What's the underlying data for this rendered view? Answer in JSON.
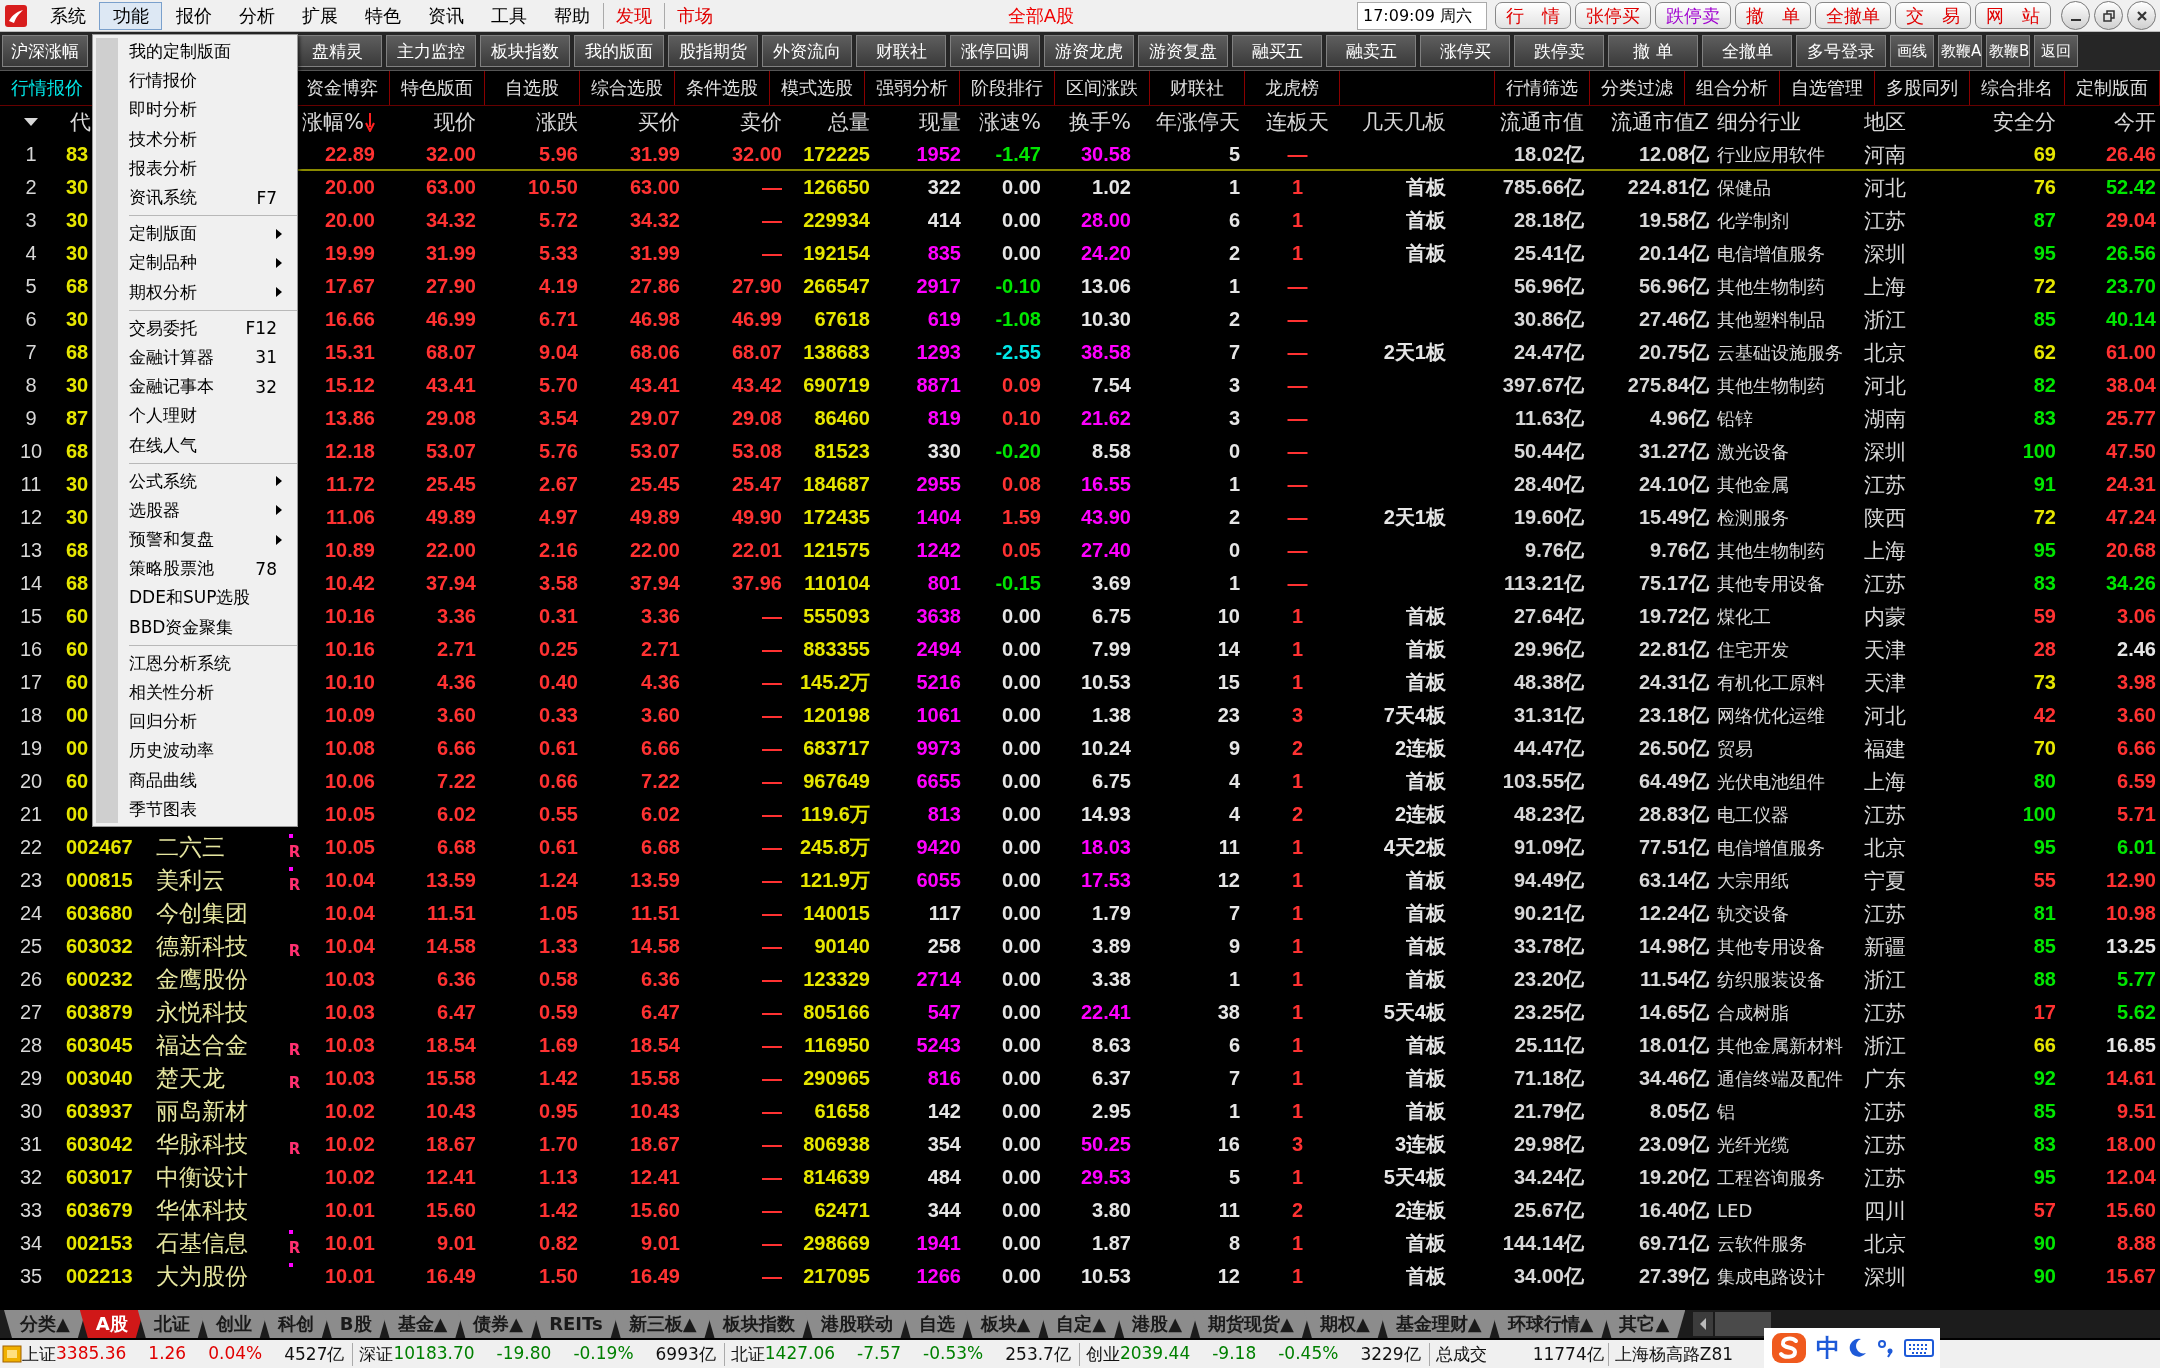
{
  "menubar": {
    "items": [
      {
        "label": "系统",
        "selected": false
      },
      {
        "label": "功能",
        "selected": true
      },
      {
        "label": "报价",
        "selected": false
      },
      {
        "label": "分析",
        "selected": false
      },
      {
        "label": "扩展",
        "selected": false
      },
      {
        "label": "特色",
        "selected": false
      },
      {
        "label": "资讯",
        "selected": false
      },
      {
        "label": "工具",
        "selected": false
      },
      {
        "label": "帮助",
        "selected": false
      }
    ],
    "links": [
      "发现",
      "市场"
    ],
    "title": "全部A股",
    "clock": "17:09:09 周六",
    "buttons": [
      {
        "label": "行　情",
        "color": "#e00000"
      },
      {
        "label": "张停买",
        "color": "#e00000"
      },
      {
        "label": "跌停卖",
        "color": "#a000d0"
      },
      {
        "label": "撤　单",
        "color": "#e00000"
      },
      {
        "label": "全撤单",
        "color": "#e00000"
      },
      {
        "label": "交　易",
        "color": "#e00000"
      },
      {
        "label": "网　站",
        "color": "#e00000"
      }
    ]
  },
  "toolbar": {
    "first": "沪深涨幅",
    "buttons": [
      {
        "label": "盘精灵",
        "kind": "wide"
      },
      {
        "label": "主力监控",
        "kind": "wide"
      },
      {
        "label": "板块指数",
        "kind": "wide"
      },
      {
        "label": "我的版面",
        "kind": "wide"
      },
      {
        "label": "股指期货",
        "kind": "wide"
      },
      {
        "label": "外资流向",
        "kind": "wide"
      },
      {
        "label": "财联社",
        "kind": "wide"
      },
      {
        "label": "涨停回调",
        "kind": "wide"
      },
      {
        "label": "游资龙虎",
        "kind": "wide"
      },
      {
        "label": "游资复盘",
        "kind": "wide"
      },
      {
        "label": "融买五",
        "kind": "wide"
      },
      {
        "label": "融卖五",
        "kind": "wide"
      },
      {
        "label": "涨停买",
        "kind": "wide"
      },
      {
        "label": "跌停卖",
        "kind": "wide"
      },
      {
        "label": "撤 单",
        "kind": "wide"
      },
      {
        "label": "全撤单",
        "kind": "wide"
      },
      {
        "label": "多号登录",
        "kind": "wide"
      },
      {
        "label": "画线",
        "kind": "small"
      },
      {
        "label": "教鞭A",
        "kind": "small"
      },
      {
        "label": "教鞭B",
        "kind": "small"
      },
      {
        "label": "返回",
        "kind": "small"
      }
    ]
  },
  "tabs_left": [
    {
      "label": "行情报价",
      "selected": true
    },
    {
      "label": "资金博弈",
      "selected": false
    },
    {
      "label": "特色版面",
      "selected": false
    },
    {
      "label": "自选股",
      "selected": false
    },
    {
      "label": "综合选股",
      "selected": false
    },
    {
      "label": "条件选股",
      "selected": false
    },
    {
      "label": "模式选股",
      "selected": false
    },
    {
      "label": "强弱分析",
      "selected": false
    },
    {
      "label": "阶段排行",
      "selected": false
    },
    {
      "label": "区间涨跌",
      "selected": false
    },
    {
      "label": "财联社",
      "selected": false
    },
    {
      "label": "龙虎榜",
      "selected": false
    }
  ],
  "tabs_right": [
    {
      "label": "行情筛选",
      "selected": false
    },
    {
      "label": "分类过滤",
      "selected": false
    },
    {
      "label": "组合分析",
      "selected": false
    },
    {
      "label": "自选管理",
      "selected": false
    },
    {
      "label": "多股同列",
      "selected": false
    },
    {
      "label": "综合排名",
      "selected": false
    },
    {
      "label": "定制版面",
      "selected": false
    }
  ],
  "table": {
    "code_header": "代",
    "columns": [
      {
        "label": "涨幅%",
        "sorted": true
      },
      {
        "label": "现价",
        "sorted": false
      },
      {
        "label": "涨跌",
        "sorted": false
      },
      {
        "label": "买价",
        "sorted": false
      },
      {
        "label": "卖价",
        "sorted": false
      },
      {
        "label": "总量",
        "sorted": false
      },
      {
        "label": "现量",
        "sorted": false
      },
      {
        "label": "涨速%",
        "sorted": false
      },
      {
        "label": "换手%",
        "sorted": false
      },
      {
        "label": "年涨停天",
        "sorted": false
      },
      {
        "label": "连板天",
        "sorted": false
      },
      {
        "label": "几天几板",
        "sorted": false
      },
      {
        "label": "流通市值",
        "sorted": false
      },
      {
        "label": "流通市值Z",
        "sorted": false
      },
      {
        "label": "细分行业",
        "sorted": false
      },
      {
        "label": "地区",
        "sorted": false
      },
      {
        "label": "安全分",
        "sorted": false
      },
      {
        "label": "今开",
        "sorted": false
      }
    ],
    "rows": [
      {
        "no": "1",
        "code": "83",
        "selected": true,
        "cells": [
          "22.89",
          "32.00",
          "5.96",
          "31.99",
          "32.00",
          "172225",
          {
            "text": "1952",
            "color": "#ff00ff"
          },
          {
            "text": "-1.47",
            "color": "#00e600"
          },
          {
            "text": "30.58",
            "color": "#ff00ff"
          },
          "5",
          "—",
          null,
          "18.02亿",
          "12.08亿",
          "行业应用软件",
          "河南",
          {
            "text": "69",
            "color": "#e6e600"
          },
          {
            "text": "26.46",
            "color": "#ff3232"
          }
        ]
      },
      {
        "no": "2",
        "code": "30",
        "selected": false,
        "cells": [
          "20.00",
          "63.00",
          "10.50",
          "63.00",
          "—",
          "126650",
          {
            "text": "322",
            "color": "#e6e6e6"
          },
          {
            "text": "0.00",
            "color": "#e6e6e6"
          },
          {
            "text": "1.02",
            "color": "#e6e6e6"
          },
          "1",
          "1",
          "首板",
          "785.66亿",
          "224.81亿",
          "保健品",
          "河北",
          {
            "text": "76",
            "color": "#e6e600"
          },
          {
            "text": "52.42",
            "color": "#00e600"
          }
        ]
      },
      {
        "no": "3",
        "code": "30",
        "selected": false,
        "cells": [
          "20.00",
          "34.32",
          "5.72",
          "34.32",
          "—",
          "229934",
          {
            "text": "414",
            "color": "#e6e6e6"
          },
          {
            "text": "0.00",
            "color": "#e6e6e6"
          },
          {
            "text": "28.00",
            "color": "#ff00ff"
          },
          "6",
          "1",
          "首板",
          "28.18亿",
          "19.58亿",
          "化学制剂",
          "江苏",
          {
            "text": "87",
            "color": "#00e600"
          },
          {
            "text": "29.04",
            "color": "#ff3232"
          }
        ]
      },
      {
        "no": "4",
        "code": "30",
        "selected": false,
        "cells": [
          "19.99",
          "31.99",
          "5.33",
          "31.99",
          "—",
          "192154",
          {
            "text": "835",
            "color": "#ff00ff"
          },
          {
            "text": "0.00",
            "color": "#e6e6e6"
          },
          {
            "text": "24.20",
            "color": "#ff00ff"
          },
          "2",
          "1",
          "首板",
          "25.41亿",
          "20.14亿",
          "电信增值服务",
          "深圳",
          {
            "text": "95",
            "color": "#00e600"
          },
          {
            "text": "26.56",
            "color": "#00e600"
          }
        ]
      },
      {
        "no": "5",
        "code": "68",
        "selected": false,
        "cells": [
          "17.67",
          "27.90",
          "4.19",
          "27.86",
          "27.90",
          "266547",
          {
            "text": "2917",
            "color": "#ff00ff"
          },
          {
            "text": "-0.10",
            "color": "#00e600"
          },
          {
            "text": "13.06",
            "color": "#e6e6e6"
          },
          "1",
          "—",
          null,
          "56.96亿",
          "56.96亿",
          "其他生物制药",
          "上海",
          {
            "text": "72",
            "color": "#e6e600"
          },
          {
            "text": "23.70",
            "color": "#00e600"
          }
        ]
      },
      {
        "no": "6",
        "code": "30",
        "selected": false,
        "cells": [
          "16.66",
          "46.99",
          "6.71",
          "46.98",
          "46.99",
          "67618",
          {
            "text": "619",
            "color": "#ff00ff"
          },
          {
            "text": "-1.08",
            "color": "#00e600"
          },
          {
            "text": "10.30",
            "color": "#e6e6e6"
          },
          "2",
          "—",
          null,
          "30.86亿",
          "27.46亿",
          "其他塑料制品",
          "浙江",
          {
            "text": "85",
            "color": "#00e600"
          },
          {
            "text": "40.14",
            "color": "#00e600"
          }
        ]
      },
      {
        "no": "7",
        "code": "68",
        "selected": false,
        "cells": [
          "15.31",
          "68.07",
          "9.04",
          "68.06",
          "68.07",
          "138683",
          {
            "text": "1293",
            "color": "#ff00ff"
          },
          {
            "text": "-2.55",
            "color": "#00e6e6"
          },
          {
            "text": "38.58",
            "color": "#ff00ff"
          },
          "7",
          "—",
          "2天1板",
          "24.47亿",
          "20.75亿",
          "云基础设施服务",
          "北京",
          {
            "text": "62",
            "color": "#e6e600"
          },
          {
            "text": "61.00",
            "color": "#ff3232"
          }
        ]
      },
      {
        "no": "8",
        "code": "30",
        "selected": false,
        "cells": [
          "15.12",
          "43.41",
          "5.70",
          "43.41",
          "43.42",
          "690719",
          {
            "text": "8871",
            "color": "#ff00ff"
          },
          {
            "text": "0.09",
            "color": "#ff3232"
          },
          {
            "text": "7.54",
            "color": "#e6e6e6"
          },
          "3",
          "—",
          null,
          "397.67亿",
          "275.84亿",
          "其他生物制药",
          "河北",
          {
            "text": "82",
            "color": "#00e600"
          },
          {
            "text": "38.04",
            "color": "#ff3232"
          }
        ]
      },
      {
        "no": "9",
        "code": "87",
        "selected": false,
        "cells": [
          "13.86",
          "29.08",
          "3.54",
          "29.07",
          "29.08",
          "86460",
          {
            "text": "819",
            "color": "#ff00ff"
          },
          {
            "text": "0.10",
            "color": "#ff3232"
          },
          {
            "text": "21.62",
            "color": "#ff00ff"
          },
          "3",
          "—",
          null,
          "11.63亿",
          "4.96亿",
          "铅锌",
          "湖南",
          {
            "text": "83",
            "color": "#00e600"
          },
          {
            "text": "25.77",
            "color": "#ff3232"
          }
        ]
      },
      {
        "no": "10",
        "code": "68",
        "selected": false,
        "cells": [
          "12.18",
          "53.07",
          "5.76",
          "53.07",
          "53.08",
          "81523",
          {
            "text": "330",
            "color": "#e6e6e6"
          },
          {
            "text": "-0.20",
            "color": "#00e600"
          },
          {
            "text": "8.58",
            "color": "#e6e6e6"
          },
          "0",
          "—",
          null,
          "50.44亿",
          "31.27亿",
          "激光设备",
          "深圳",
          {
            "text": "100",
            "color": "#00e600"
          },
          {
            "text": "47.50",
            "color": "#ff3232"
          }
        ]
      },
      {
        "no": "11",
        "code": "30",
        "selected": false,
        "cells": [
          "11.72",
          "25.45",
          "2.67",
          "25.45",
          "25.47",
          "184687",
          {
            "text": "2955",
            "color": "#ff00ff"
          },
          {
            "text": "0.08",
            "color": "#ff3232"
          },
          {
            "text": "16.55",
            "color": "#ff00ff"
          },
          "1",
          "—",
          null,
          "28.40亿",
          "24.10亿",
          "其他金属",
          "江苏",
          {
            "text": "91",
            "color": "#00e600"
          },
          {
            "text": "24.31",
            "color": "#ff3232"
          }
        ]
      },
      {
        "no": "12",
        "code": "30",
        "selected": false,
        "cells": [
          "11.06",
          "49.89",
          "4.97",
          "49.89",
          "49.90",
          "172435",
          {
            "text": "1404",
            "color": "#ff00ff"
          },
          {
            "text": "1.59",
            "color": "#ff3232"
          },
          {
            "text": "43.90",
            "color": "#ff00ff"
          },
          "2",
          "—",
          "2天1板",
          "19.60亿",
          "15.49亿",
          "检测服务",
          "陕西",
          {
            "text": "72",
            "color": "#e6e600"
          },
          {
            "text": "47.24",
            "color": "#ff3232"
          }
        ]
      },
      {
        "no": "13",
        "code": "68",
        "selected": false,
        "cells": [
          "10.89",
          "22.00",
          "2.16",
          "22.00",
          "22.01",
          "121575",
          {
            "text": "1242",
            "color": "#ff00ff"
          },
          {
            "text": "0.05",
            "color": "#ff3232"
          },
          {
            "text": "27.40",
            "color": "#ff00ff"
          },
          "0",
          "—",
          null,
          "9.76亿",
          "9.76亿",
          "其他生物制药",
          "上海",
          {
            "text": "95",
            "color": "#00e600"
          },
          {
            "text": "20.68",
            "color": "#ff3232"
          }
        ]
      },
      {
        "no": "14",
        "code": "68",
        "selected": false,
        "cells": [
          "10.42",
          "37.94",
          "3.58",
          "37.94",
          "37.96",
          "110104",
          {
            "text": "801",
            "color": "#ff00ff"
          },
          {
            "text": "-0.15",
            "color": "#00e600"
          },
          {
            "text": "3.69",
            "color": "#e6e6e6"
          },
          "1",
          "—",
          null,
          "113.21亿",
          "75.17亿",
          "其他专用设备",
          "江苏",
          {
            "text": "83",
            "color": "#00e600"
          },
          {
            "text": "34.26",
            "color": "#00e600"
          }
        ]
      },
      {
        "no": "15",
        "code": "60",
        "selected": false,
        "cells": [
          "10.16",
          "3.36",
          "0.31",
          "3.36",
          "—",
          "555093",
          {
            "text": "3638",
            "color": "#ff00ff"
          },
          {
            "text": "0.00",
            "color": "#e6e6e6"
          },
          {
            "text": "6.75",
            "color": "#e6e6e6"
          },
          "10",
          "1",
          "首板",
          "27.64亿",
          "19.72亿",
          "煤化工",
          "内蒙",
          {
            "text": "59",
            "color": "#ff3232"
          },
          {
            "text": "3.06",
            "color": "#ff3232"
          }
        ]
      },
      {
        "no": "16",
        "code": "60",
        "selected": false,
        "cells": [
          "10.16",
          "2.71",
          "0.25",
          "2.71",
          "—",
          "883355",
          {
            "text": "2494",
            "color": "#ff00ff"
          },
          {
            "text": "0.00",
            "color": "#e6e6e6"
          },
          {
            "text": "7.99",
            "color": "#e6e6e6"
          },
          "14",
          "1",
          "首板",
          "29.96亿",
          "22.81亿",
          "住宅开发",
          "天津",
          {
            "text": "28",
            "color": "#ff3232"
          },
          {
            "text": "2.46",
            "color": "#e6e6e6"
          }
        ]
      },
      {
        "no": "17",
        "code": "60",
        "selected": false,
        "cells": [
          "10.10",
          "4.36",
          "0.40",
          "4.36",
          "—",
          "145.2万",
          {
            "text": "5216",
            "color": "#ff00ff"
          },
          {
            "text": "0.00",
            "color": "#e6e6e6"
          },
          {
            "text": "10.53",
            "color": "#e6e6e6"
          },
          "15",
          "1",
          "首板",
          "48.38亿",
          "24.31亿",
          "有机化工原料",
          "天津",
          {
            "text": "73",
            "color": "#e6e600"
          },
          {
            "text": "3.98",
            "color": "#ff3232"
          }
        ]
      },
      {
        "no": "18",
        "code": "00",
        "selected": false,
        "cells": [
          "10.09",
          "3.60",
          "0.33",
          "3.60",
          "—",
          "120198",
          {
            "text": "1061",
            "color": "#ff00ff"
          },
          {
            "text": "0.00",
            "color": "#e6e6e6"
          },
          {
            "text": "1.38",
            "color": "#e6e6e6"
          },
          "23",
          "3",
          "7天4板",
          "31.31亿",
          "23.18亿",
          "网络优化运维",
          "河北",
          {
            "text": "42",
            "color": "#ff3232"
          },
          {
            "text": "3.60",
            "color": "#ff3232"
          }
        ]
      },
      {
        "no": "19",
        "code": "00",
        "selected": false,
        "cells": [
          "10.08",
          "6.66",
          "0.61",
          "6.66",
          "—",
          "683717",
          {
            "text": "9973",
            "color": "#ff00ff"
          },
          {
            "text": "0.00",
            "color": "#e6e6e6"
          },
          {
            "text": "10.24",
            "color": "#e6e6e6"
          },
          "9",
          "2",
          "2连板",
          "44.47亿",
          "26.50亿",
          "贸易",
          "福建",
          {
            "text": "70",
            "color": "#e6e600"
          },
          {
            "text": "6.66",
            "color": "#ff3232"
          }
        ]
      },
      {
        "no": "20",
        "code": "60",
        "selected": false,
        "cells": [
          "10.06",
          "7.22",
          "0.66",
          "7.22",
          "—",
          "967649",
          {
            "text": "6655",
            "color": "#ff00ff"
          },
          {
            "text": "0.00",
            "color": "#e6e6e6"
          },
          {
            "text": "6.75",
            "color": "#e6e6e6"
          },
          "4",
          "1",
          "首板",
          "103.55亿",
          "64.49亿",
          "光伏电池组件",
          "上海",
          {
            "text": "80",
            "color": "#00e600"
          },
          {
            "text": "6.59",
            "color": "#ff3232"
          }
        ]
      },
      {
        "no": "21",
        "code": "00",
        "selected": false,
        "cells": [
          "10.05",
          "6.02",
          "0.55",
          "6.02",
          "—",
          "119.6万",
          {
            "text": "813",
            "color": "#ff00ff"
          },
          {
            "text": "0.00",
            "color": "#e6e6e6"
          },
          {
            "text": "14.93",
            "color": "#e6e6e6"
          },
          "4",
          "2",
          "2连板",
          "48.23亿",
          "28.83亿",
          "电工仪器",
          "江苏",
          {
            "text": "100",
            "color": "#00e600"
          },
          {
            "text": "5.71",
            "color": "#ff3232"
          }
        ]
      },
      {
        "no": "22",
        "code": "002467",
        "name": "二六三",
        "flag": "R",
        "dot": true,
        "selected": false,
        "cells": [
          "10.05",
          "6.68",
          "0.61",
          "6.68",
          "—",
          "245.8万",
          {
            "text": "9420",
            "color": "#ff00ff"
          },
          {
            "text": "0.00",
            "color": "#e6e6e6"
          },
          {
            "text": "18.03",
            "color": "#ff00ff"
          },
          "11",
          "1",
          "4天2板",
          "91.09亿",
          "77.51亿",
          "电信增值服务",
          "北京",
          {
            "text": "95",
            "color": "#00e600"
          },
          {
            "text": "6.01",
            "color": "#00e600"
          }
        ]
      },
      {
        "no": "23",
        "code": "000815",
        "name": "美利云",
        "flag": "R",
        "dot": true,
        "selected": false,
        "cells": [
          "10.04",
          "13.59",
          "1.24",
          "13.59",
          "—",
          "121.9万",
          {
            "text": "6055",
            "color": "#ff00ff"
          },
          {
            "text": "0.00",
            "color": "#e6e6e6"
          },
          {
            "text": "17.53",
            "color": "#ff00ff"
          },
          "12",
          "1",
          "首板",
          "94.49亿",
          "63.14亿",
          "大宗用纸",
          "宁夏",
          {
            "text": "55",
            "color": "#ff3232"
          },
          {
            "text": "12.90",
            "color": "#ff3232"
          }
        ]
      },
      {
        "no": "24",
        "code": "603680",
        "name": "今创集团",
        "dot": false,
        "selected": false,
        "cells": [
          "10.04",
          "11.51",
          "1.05",
          "11.51",
          "—",
          "140015",
          {
            "text": "117",
            "color": "#e6e6e6"
          },
          {
            "text": "0.00",
            "color": "#e6e6e6"
          },
          {
            "text": "1.79",
            "color": "#e6e6e6"
          },
          "7",
          "1",
          "首板",
          "90.21亿",
          "12.24亿",
          "轨交设备",
          "江苏",
          {
            "text": "81",
            "color": "#00e600"
          },
          {
            "text": "10.98",
            "color": "#ff3232"
          }
        ]
      },
      {
        "no": "25",
        "code": "603032",
        "name": "德新科技",
        "flag": "R",
        "dot": false,
        "selected": false,
        "cells": [
          "10.04",
          "14.58",
          "1.33",
          "14.58",
          "—",
          "90140",
          {
            "text": "258",
            "color": "#e6e6e6"
          },
          {
            "text": "0.00",
            "color": "#e6e6e6"
          },
          {
            "text": "3.89",
            "color": "#e6e6e6"
          },
          "9",
          "1",
          "首板",
          "33.78亿",
          "14.98亿",
          "其他专用设备",
          "新疆",
          {
            "text": "85",
            "color": "#00e600"
          },
          {
            "text": "13.25",
            "color": "#e6e6e6"
          }
        ]
      },
      {
        "no": "26",
        "code": "600232",
        "name": "金鹰股份",
        "dot": false,
        "selected": false,
        "cells": [
          "10.03",
          "6.36",
          "0.58",
          "6.36",
          "—",
          "123329",
          {
            "text": "2714",
            "color": "#ff00ff"
          },
          {
            "text": "0.00",
            "color": "#e6e6e6"
          },
          {
            "text": "3.38",
            "color": "#e6e6e6"
          },
          "1",
          "1",
          "首板",
          "23.20亿",
          "11.54亿",
          "纺织服装设备",
          "浙江",
          {
            "text": "88",
            "color": "#00e600"
          },
          {
            "text": "5.77",
            "color": "#00e600"
          }
        ]
      },
      {
        "no": "27",
        "code": "603879",
        "name": "永悦科技",
        "dot": false,
        "selected": false,
        "cells": [
          "10.03",
          "6.47",
          "0.59",
          "6.47",
          "—",
          "805166",
          {
            "text": "547",
            "color": "#ff00ff"
          },
          {
            "text": "0.00",
            "color": "#e6e6e6"
          },
          {
            "text": "22.41",
            "color": "#ff00ff"
          },
          "38",
          "1",
          "5天4板",
          "23.25亿",
          "14.65亿",
          "合成树脂",
          "江苏",
          {
            "text": "17",
            "color": "#ff3232"
          },
          {
            "text": "5.62",
            "color": "#00e600"
          }
        ]
      },
      {
        "no": "28",
        "code": "603045",
        "name": "福达合金",
        "flag": "R",
        "dot": false,
        "selected": false,
        "cells": [
          "10.03",
          "18.54",
          "1.69",
          "18.54",
          "—",
          "116950",
          {
            "text": "5243",
            "color": "#ff00ff"
          },
          {
            "text": "0.00",
            "color": "#e6e6e6"
          },
          {
            "text": "8.63",
            "color": "#e6e6e6"
          },
          "6",
          "1",
          "首板",
          "25.11亿",
          "18.01亿",
          "其他金属新材料",
          "浙江",
          {
            "text": "66",
            "color": "#e6e600"
          },
          {
            "text": "16.85",
            "color": "#e6e6e6"
          }
        ]
      },
      {
        "no": "29",
        "code": "003040",
        "name": "楚天龙",
        "flag": "R",
        "dot": false,
        "selected": false,
        "cells": [
          "10.03",
          "15.58",
          "1.42",
          "15.58",
          "—",
          "290965",
          {
            "text": "816",
            "color": "#ff00ff"
          },
          {
            "text": "0.00",
            "color": "#e6e6e6"
          },
          {
            "text": "6.37",
            "color": "#e6e6e6"
          },
          "7",
          "1",
          "首板",
          "71.18亿",
          "34.46亿",
          "通信终端及配件",
          "广东",
          {
            "text": "92",
            "color": "#00e600"
          },
          {
            "text": "14.61",
            "color": "#ff3232"
          }
        ]
      },
      {
        "no": "30",
        "code": "603937",
        "name": "丽岛新材",
        "dot": false,
        "selected": false,
        "cells": [
          "10.02",
          "10.43",
          "0.95",
          "10.43",
          "—",
          "61658",
          {
            "text": "142",
            "color": "#e6e6e6"
          },
          {
            "text": "0.00",
            "color": "#e6e6e6"
          },
          {
            "text": "2.95",
            "color": "#e6e6e6"
          },
          "1",
          "1",
          "首板",
          "21.79亿",
          "8.05亿",
          "铝",
          "江苏",
          {
            "text": "85",
            "color": "#00e600"
          },
          {
            "text": "9.51",
            "color": "#ff3232"
          }
        ]
      },
      {
        "no": "31",
        "code": "603042",
        "name": "华脉科技",
        "flag": "R",
        "dot": false,
        "selected": false,
        "cells": [
          "10.02",
          "18.67",
          "1.70",
          "18.67",
          "—",
          "806938",
          {
            "text": "354",
            "color": "#e6e6e6"
          },
          {
            "text": "0.00",
            "color": "#e6e6e6"
          },
          {
            "text": "50.25",
            "color": "#ff00ff"
          },
          "16",
          "3",
          "3连板",
          "29.98亿",
          "23.09亿",
          "光纤光缆",
          "江苏",
          {
            "text": "83",
            "color": "#00e600"
          },
          {
            "text": "18.00",
            "color": "#ff3232"
          }
        ]
      },
      {
        "no": "32",
        "code": "603017",
        "name": "中衡设计",
        "dot": false,
        "selected": false,
        "cells": [
          "10.02",
          "12.41",
          "1.13",
          "12.41",
          "—",
          "814639",
          {
            "text": "484",
            "color": "#e6e6e6"
          },
          {
            "text": "0.00",
            "color": "#e6e6e6"
          },
          {
            "text": "29.53",
            "color": "#ff00ff"
          },
          "5",
          "1",
          "5天4板",
          "34.24亿",
          "19.20亿",
          "工程咨询服务",
          "江苏",
          {
            "text": "95",
            "color": "#00e600"
          },
          {
            "text": "12.04",
            "color": "#ff3232"
          }
        ]
      },
      {
        "no": "33",
        "code": "603679",
        "name": "华体科技",
        "dot": false,
        "selected": false,
        "cells": [
          "10.01",
          "15.60",
          "1.42",
          "15.60",
          "—",
          "62471",
          {
            "text": "344",
            "color": "#e6e6e6"
          },
          {
            "text": "0.00",
            "color": "#e6e6e6"
          },
          {
            "text": "3.80",
            "color": "#e6e6e6"
          },
          "11",
          "2",
          "2连板",
          "25.67亿",
          "16.40亿",
          "LED",
          "四川",
          {
            "text": "57",
            "color": "#ff3232"
          },
          {
            "text": "15.60",
            "color": "#ff3232"
          }
        ]
      },
      {
        "no": "34",
        "code": "002153",
        "name": "石基信息",
        "flag": "R",
        "dot": true,
        "selected": false,
        "cells": [
          "10.01",
          "9.01",
          "0.82",
          "9.01",
          "—",
          "298669",
          {
            "text": "1941",
            "color": "#ff00ff"
          },
          {
            "text": "0.00",
            "color": "#e6e6e6"
          },
          {
            "text": "1.87",
            "color": "#e6e6e6"
          },
          "8",
          "1",
          "首板",
          "144.14亿",
          "69.71亿",
          "云软件服务",
          "北京",
          {
            "text": "90",
            "color": "#00e600"
          },
          {
            "text": "8.88",
            "color": "#ff3232"
          }
        ]
      },
      {
        "no": "35",
        "code": "002213",
        "name": "大为股份",
        "dot": true,
        "selected": false,
        "cells": [
          "10.01",
          "16.49",
          "1.50",
          "16.49",
          "—",
          "217095",
          {
            "text": "1266",
            "color": "#ff00ff"
          },
          {
            "text": "0.00",
            "color": "#e6e6e6"
          },
          {
            "text": "10.53",
            "color": "#e6e6e6"
          },
          "12",
          "1",
          "首板",
          "34.00亿",
          "27.39亿",
          "集成电路设计",
          "深圳",
          {
            "text": "90",
            "color": "#00e600"
          },
          {
            "text": "15.67",
            "color": "#ff3232"
          }
        ]
      }
    ]
  },
  "menu": {
    "groups": [
      {
        "items": [
          {
            "label": "我的定制版面",
            "submenu": false
          },
          {
            "label": "行情报价",
            "submenu": false
          },
          {
            "label": "即时分析",
            "submenu": false
          },
          {
            "label": "技术分析",
            "submenu": false
          },
          {
            "label": "报表分析",
            "submenu": false
          },
          {
            "label": "资讯系统",
            "shortcut": "F7",
            "submenu": false
          }
        ]
      },
      {
        "items": [
          {
            "label": "定制版面",
            "submenu": true
          },
          {
            "label": "定制品种",
            "submenu": true
          },
          {
            "label": "期权分析",
            "submenu": true
          }
        ]
      },
      {
        "items": [
          {
            "label": "交易委托",
            "shortcut": "F12",
            "submenu": false
          },
          {
            "label": "金融计算器",
            "shortcut": "31",
            "submenu": false
          },
          {
            "label": "金融记事本",
            "shortcut": "32",
            "submenu": false
          },
          {
            "label": "个人理财",
            "submenu": false
          },
          {
            "label": "在线人气",
            "submenu": false
          }
        ]
      },
      {
        "items": [
          {
            "label": "公式系统",
            "submenu": true
          },
          {
            "label": "选股器",
            "submenu": true
          },
          {
            "label": "预警和复盘",
            "submenu": true
          },
          {
            "label": "策略股票池",
            "shortcut": "78",
            "submenu": false
          },
          {
            "label": "DDE和SUP选股",
            "submenu": false
          },
          {
            "label": "BBD资金聚集",
            "submenu": false
          }
        ]
      },
      {
        "items": [
          {
            "label": "江恩分析系统",
            "submenu": false
          },
          {
            "label": "相关性分析",
            "submenu": false
          },
          {
            "label": "回归分析",
            "submenu": false
          },
          {
            "label": "历史波动率",
            "submenu": false
          },
          {
            "label": "商品曲线",
            "submenu": false
          },
          {
            "label": "季节图表",
            "submenu": false
          }
        ]
      }
    ]
  },
  "bottom_tabs": [
    {
      "label": "分类▲",
      "selected": false
    },
    {
      "label": "A股",
      "selected": true
    },
    {
      "label": "北证",
      "selected": false
    },
    {
      "label": "创业",
      "selected": false
    },
    {
      "label": "科创",
      "selected": false
    },
    {
      "label": "B股",
      "selected": false
    },
    {
      "label": "基金▲",
      "selected": false
    },
    {
      "label": "债券▲",
      "selected": false
    },
    {
      "label": "REITs",
      "selected": false
    },
    {
      "label": "新三板▲",
      "selected": false
    },
    {
      "label": "板块指数",
      "selected": false
    },
    {
      "label": "港股联动",
      "selected": false
    },
    {
      "label": "自选",
      "selected": false
    },
    {
      "label": "板块▲",
      "selected": false
    },
    {
      "label": "自定▲",
      "selected": false
    },
    {
      "label": "港股▲",
      "selected": false
    },
    {
      "label": "期货现货▲",
      "selected": false
    },
    {
      "label": "期权▲",
      "selected": false
    },
    {
      "label": "基金理财▲",
      "selected": false
    },
    {
      "label": "环球行情▲",
      "selected": false
    },
    {
      "label": "其它▲",
      "selected": false
    }
  ],
  "status_bar": {
    "indices": [
      {
        "name": "上证",
        "value": "3385.36",
        "change": "1.26",
        "pct": "0.04%",
        "amount": "4527亿",
        "color": "#e00000"
      },
      {
        "name": "深证",
        "value": "10183.70",
        "change": "-19.80",
        "pct": "-0.19%",
        "amount": "6993亿",
        "color": "#008000"
      },
      {
        "name": "北证",
        "value": "1427.06",
        "change": "-7.57",
        "pct": "-0.53%",
        "amount": "253.7亿",
        "color": "#008000"
      },
      {
        "name": "创业",
        "value": "2039.44",
        "change": "-9.18",
        "pct": "-0.45%",
        "amount": "3229亿",
        "color": "#008000"
      }
    ],
    "total_label": "总成交",
    "total": "11774亿",
    "location": "上海杨高路Z81"
  },
  "ime": {
    "mode": "中"
  }
}
